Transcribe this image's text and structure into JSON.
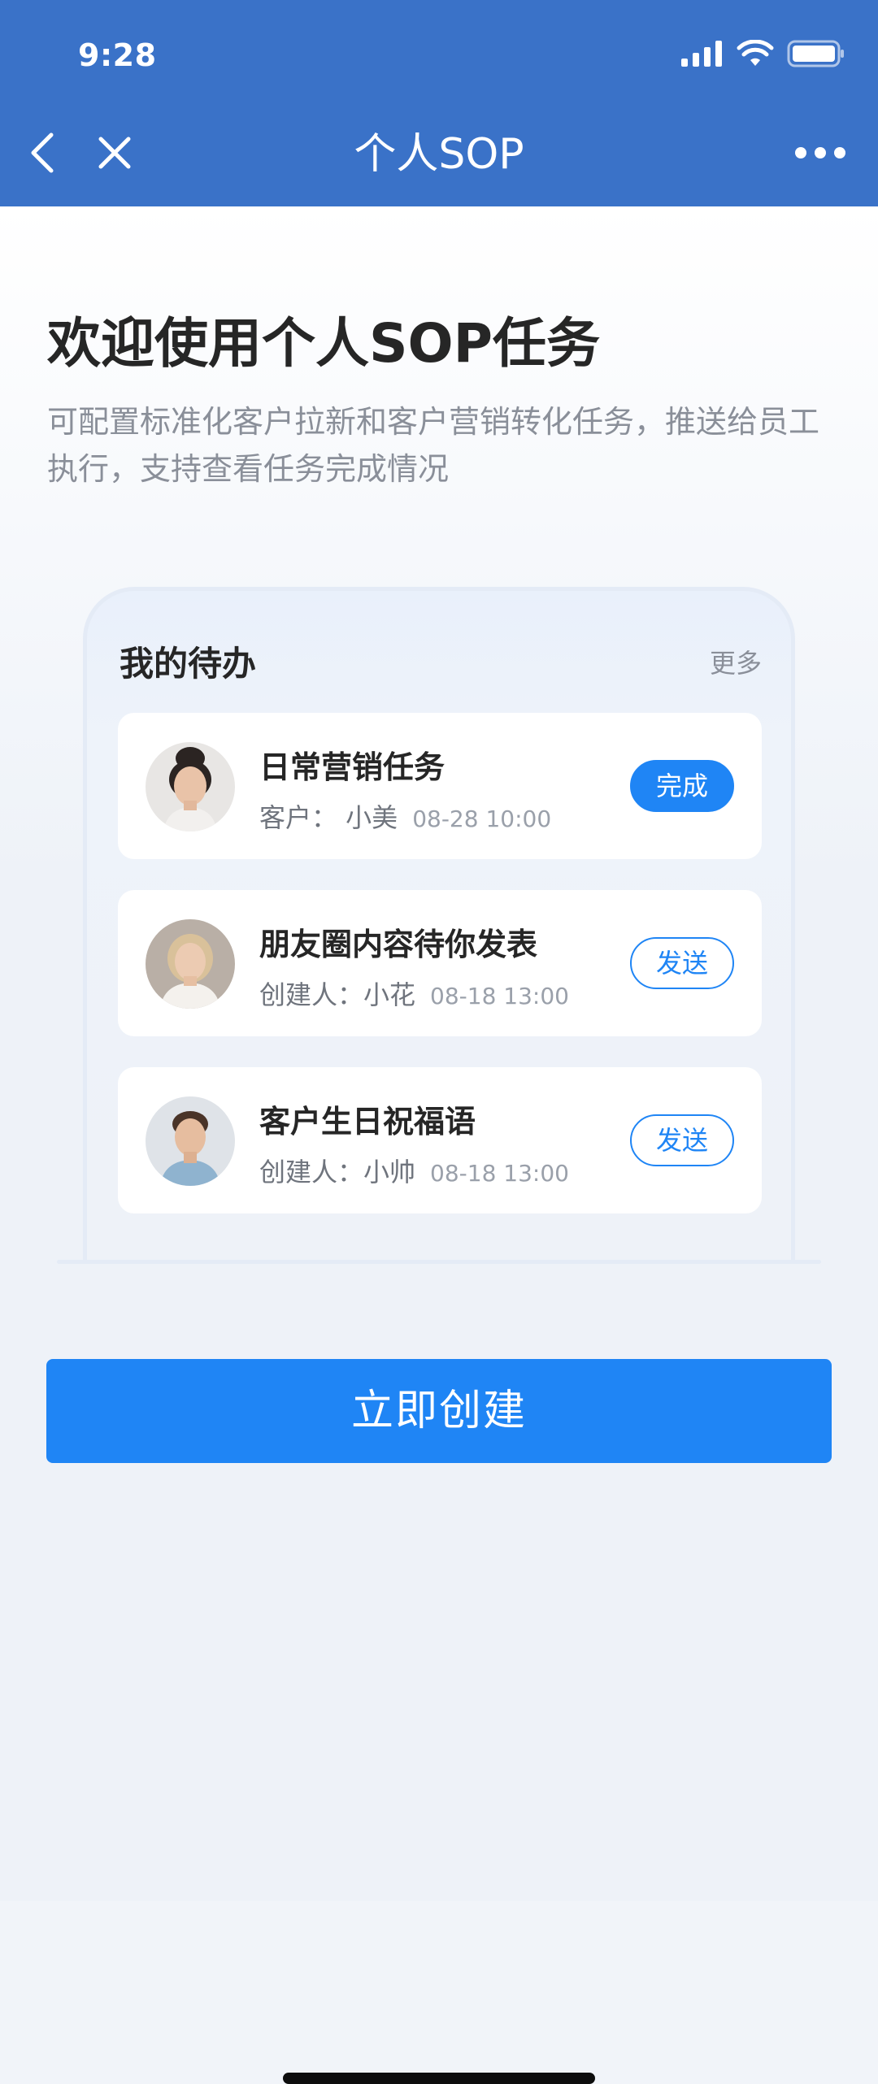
{
  "status_bar": {
    "time": "9:28"
  },
  "nav": {
    "title": "个人SOP",
    "back_icon": "chevron-left-icon",
    "close_icon": "close-icon",
    "more_icon": "more-dots-icon"
  },
  "welcome": {
    "title": "欢迎使用个人SOP任务",
    "description": "可配置标准化客户拉新和客户营销转化任务，推送给员工执行，支持查看任务完成情况"
  },
  "todo": {
    "title": "我的待办",
    "more": "更多",
    "items": [
      {
        "name": "日常营销任务",
        "who": "客户：  小美",
        "time": "08-28 10:00",
        "action": "完成",
        "action_style": "solid"
      },
      {
        "name": "朋友圈内容待你发表",
        "who": "创建人：小花",
        "time": "08-18 13:00",
        "action": "发送",
        "action_style": "outline"
      },
      {
        "name": "客户生日祝福语",
        "who": "创建人：小帅",
        "time": "08-18 13:00",
        "action": "发送",
        "action_style": "outline"
      }
    ]
  },
  "create_button": {
    "label": "立即创建"
  },
  "colors": {
    "header": "#3a72c8",
    "primary": "#1f85f5"
  }
}
